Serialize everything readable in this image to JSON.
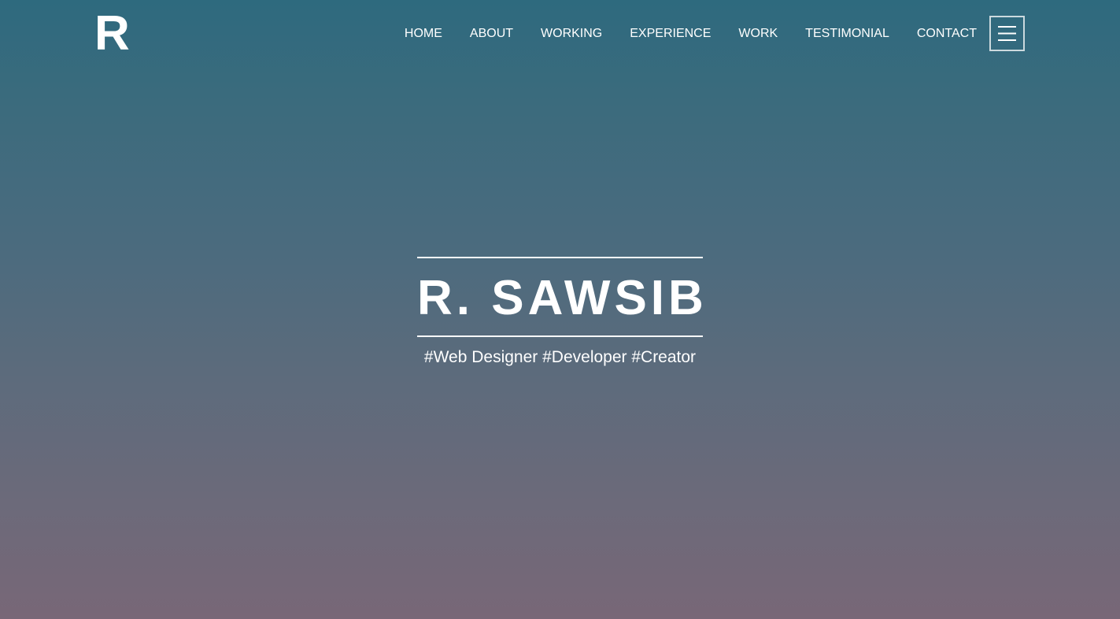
{
  "header": {
    "logo": "R",
    "nav": [
      {
        "label": "HOME"
      },
      {
        "label": "ABOUT"
      },
      {
        "label": "WORKING"
      },
      {
        "label": "EXPERIENCE"
      },
      {
        "label": "WORK"
      },
      {
        "label": "TESTIMONIAL"
      },
      {
        "label": "CONTACT"
      }
    ],
    "menu_icon": "hamburger-menu-icon"
  },
  "hero": {
    "title": "R. SAWSIB",
    "tagline": "#Web Designer #Developer #Creator"
  },
  "colors": {
    "gradient_top": "#2e6a7e",
    "gradient_bottom": "#786777",
    "text": "#ffffff"
  }
}
